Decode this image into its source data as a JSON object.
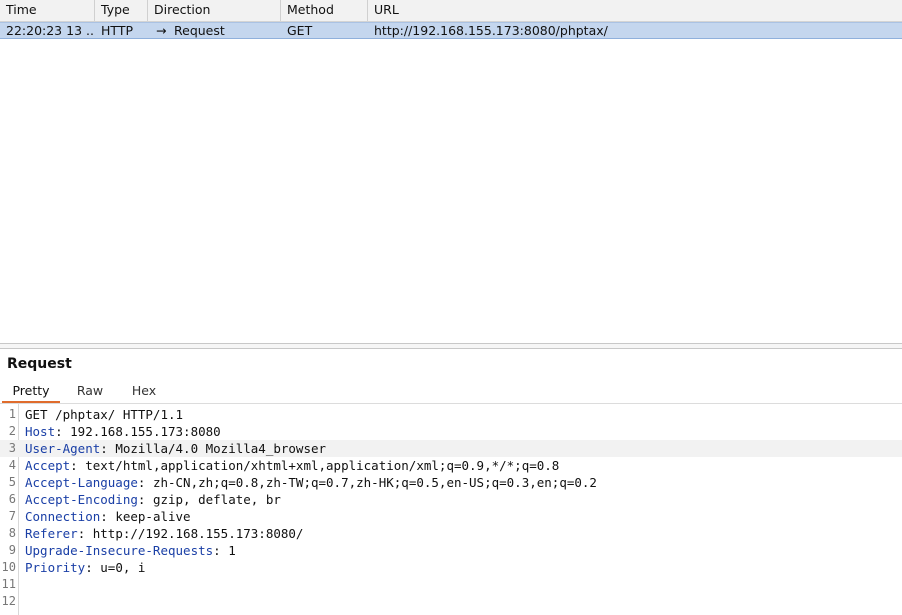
{
  "table": {
    "headers": [
      "Time",
      "Type",
      "Direction",
      "Method",
      "URL"
    ],
    "rows": [
      {
        "time": "22:20:23 13 ...",
        "type": "HTTP",
        "direction": "Request",
        "direction_icon": "arrow-right-icon",
        "method": "GET",
        "url": "http://192.168.155.173:8080/phptax/"
      }
    ]
  },
  "request_pane": {
    "title": "Request",
    "tabs": [
      "Pretty",
      "Raw",
      "Hex"
    ],
    "active_tab": "Pretty",
    "lines": [
      {
        "num": "1",
        "key": "",
        "text": "GET /phptax/ HTTP/1.1"
      },
      {
        "num": "2",
        "key": "Host",
        "text": ": 192.168.155.173:8080"
      },
      {
        "num": "3",
        "key": "User-Agent",
        "text": ": Mozilla/4.0 Mozilla4_browser"
      },
      {
        "num": "4",
        "key": "Accept",
        "text": ": text/html,application/xhtml+xml,application/xml;q=0.9,*/*;q=0.8"
      },
      {
        "num": "5",
        "key": "Accept-Language",
        "text": ": zh-CN,zh;q=0.8,zh-TW;q=0.7,zh-HK;q=0.5,en-US;q=0.3,en;q=0.2"
      },
      {
        "num": "6",
        "key": "Accept-Encoding",
        "text": ": gzip, deflate, br"
      },
      {
        "num": "7",
        "key": "Connection",
        "text": ": keep-alive"
      },
      {
        "num": "8",
        "key": "Referer",
        "text": ": http://192.168.155.173:8080/"
      },
      {
        "num": "9",
        "key": "Upgrade-Insecure-Requests",
        "text": ": 1"
      },
      {
        "num": "10",
        "key": "Priority",
        "text": ": u=0, i"
      },
      {
        "num": "11",
        "key": "",
        "text": ""
      },
      {
        "num": "12",
        "key": "",
        "text": ""
      }
    ]
  },
  "colors": {
    "selected_row": "#c4d6ee",
    "active_tab_underline": "#e06c2c",
    "header_key": "#1a3fa6"
  }
}
